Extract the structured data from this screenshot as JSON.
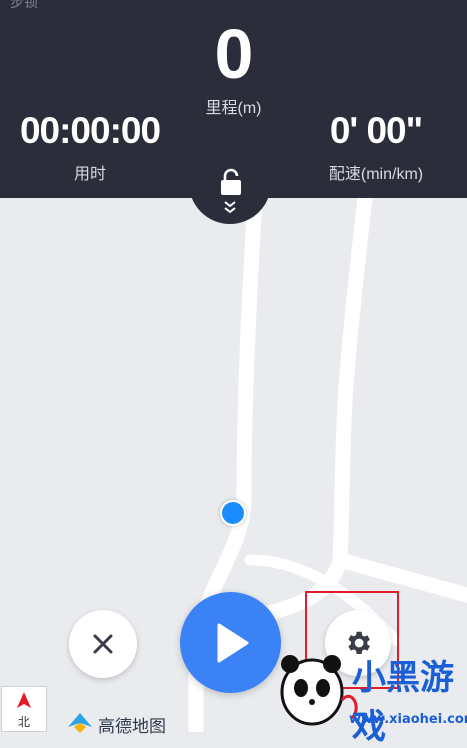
{
  "status_bar": {
    "clipped_text": "步锁"
  },
  "stats": {
    "distance": {
      "value": "0",
      "label": "里程(m)"
    },
    "duration": {
      "value": "00:00:00",
      "label": "用时"
    },
    "pace": {
      "value": "0' 00\"",
      "label": "配速(min/km)"
    }
  },
  "icons": {
    "lock": "lock-icon",
    "chevron": "double-chevron-down-icon",
    "close": "close-icon",
    "play": "play-icon",
    "settings": "gear-icon",
    "compass": "north-arrow-icon"
  },
  "map": {
    "compass_label": "北",
    "provider_label": "高德地图"
  },
  "watermark": {
    "title": "小黑游戏",
    "url": "www.xiaohei.com"
  },
  "colors": {
    "panel": "#2b2d3a",
    "accent": "#3b82f6",
    "location_dot": "#1a8cff",
    "highlight": "#e11d2a",
    "map_bg": "#e9ebee"
  }
}
